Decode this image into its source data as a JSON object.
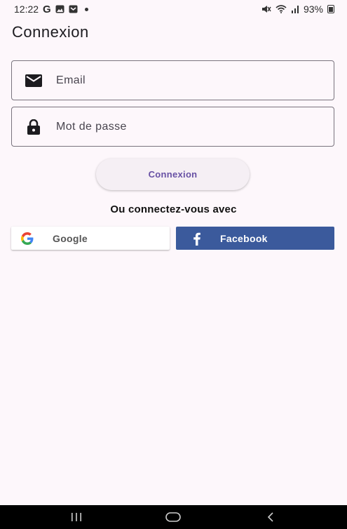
{
  "status_bar": {
    "time": "12:22",
    "g_label": "G",
    "battery_text": "93%",
    "icons": [
      "google-icon",
      "photo-icon",
      "mail-icon",
      "dot-icon",
      "mute-icon",
      "wifi-icon",
      "signal-icon",
      "battery-icon"
    ]
  },
  "page": {
    "title": "Connexion"
  },
  "form": {
    "email_placeholder": "Email",
    "password_placeholder": "Mot de passe",
    "email_icon": "mail-icon",
    "password_icon": "lock-icon",
    "submit_label": "Connexion"
  },
  "social": {
    "divider_text": "Ou connectez-vous avec",
    "google_label": "Google",
    "facebook_label": "Facebook"
  },
  "navigation": {
    "buttons": [
      "recents-icon",
      "home-icon",
      "back-icon"
    ]
  },
  "colors": {
    "background": "#fdf7fb",
    "accent": "#6750a4",
    "facebook_blue": "#3b5a9c",
    "outline": "#79747e"
  }
}
